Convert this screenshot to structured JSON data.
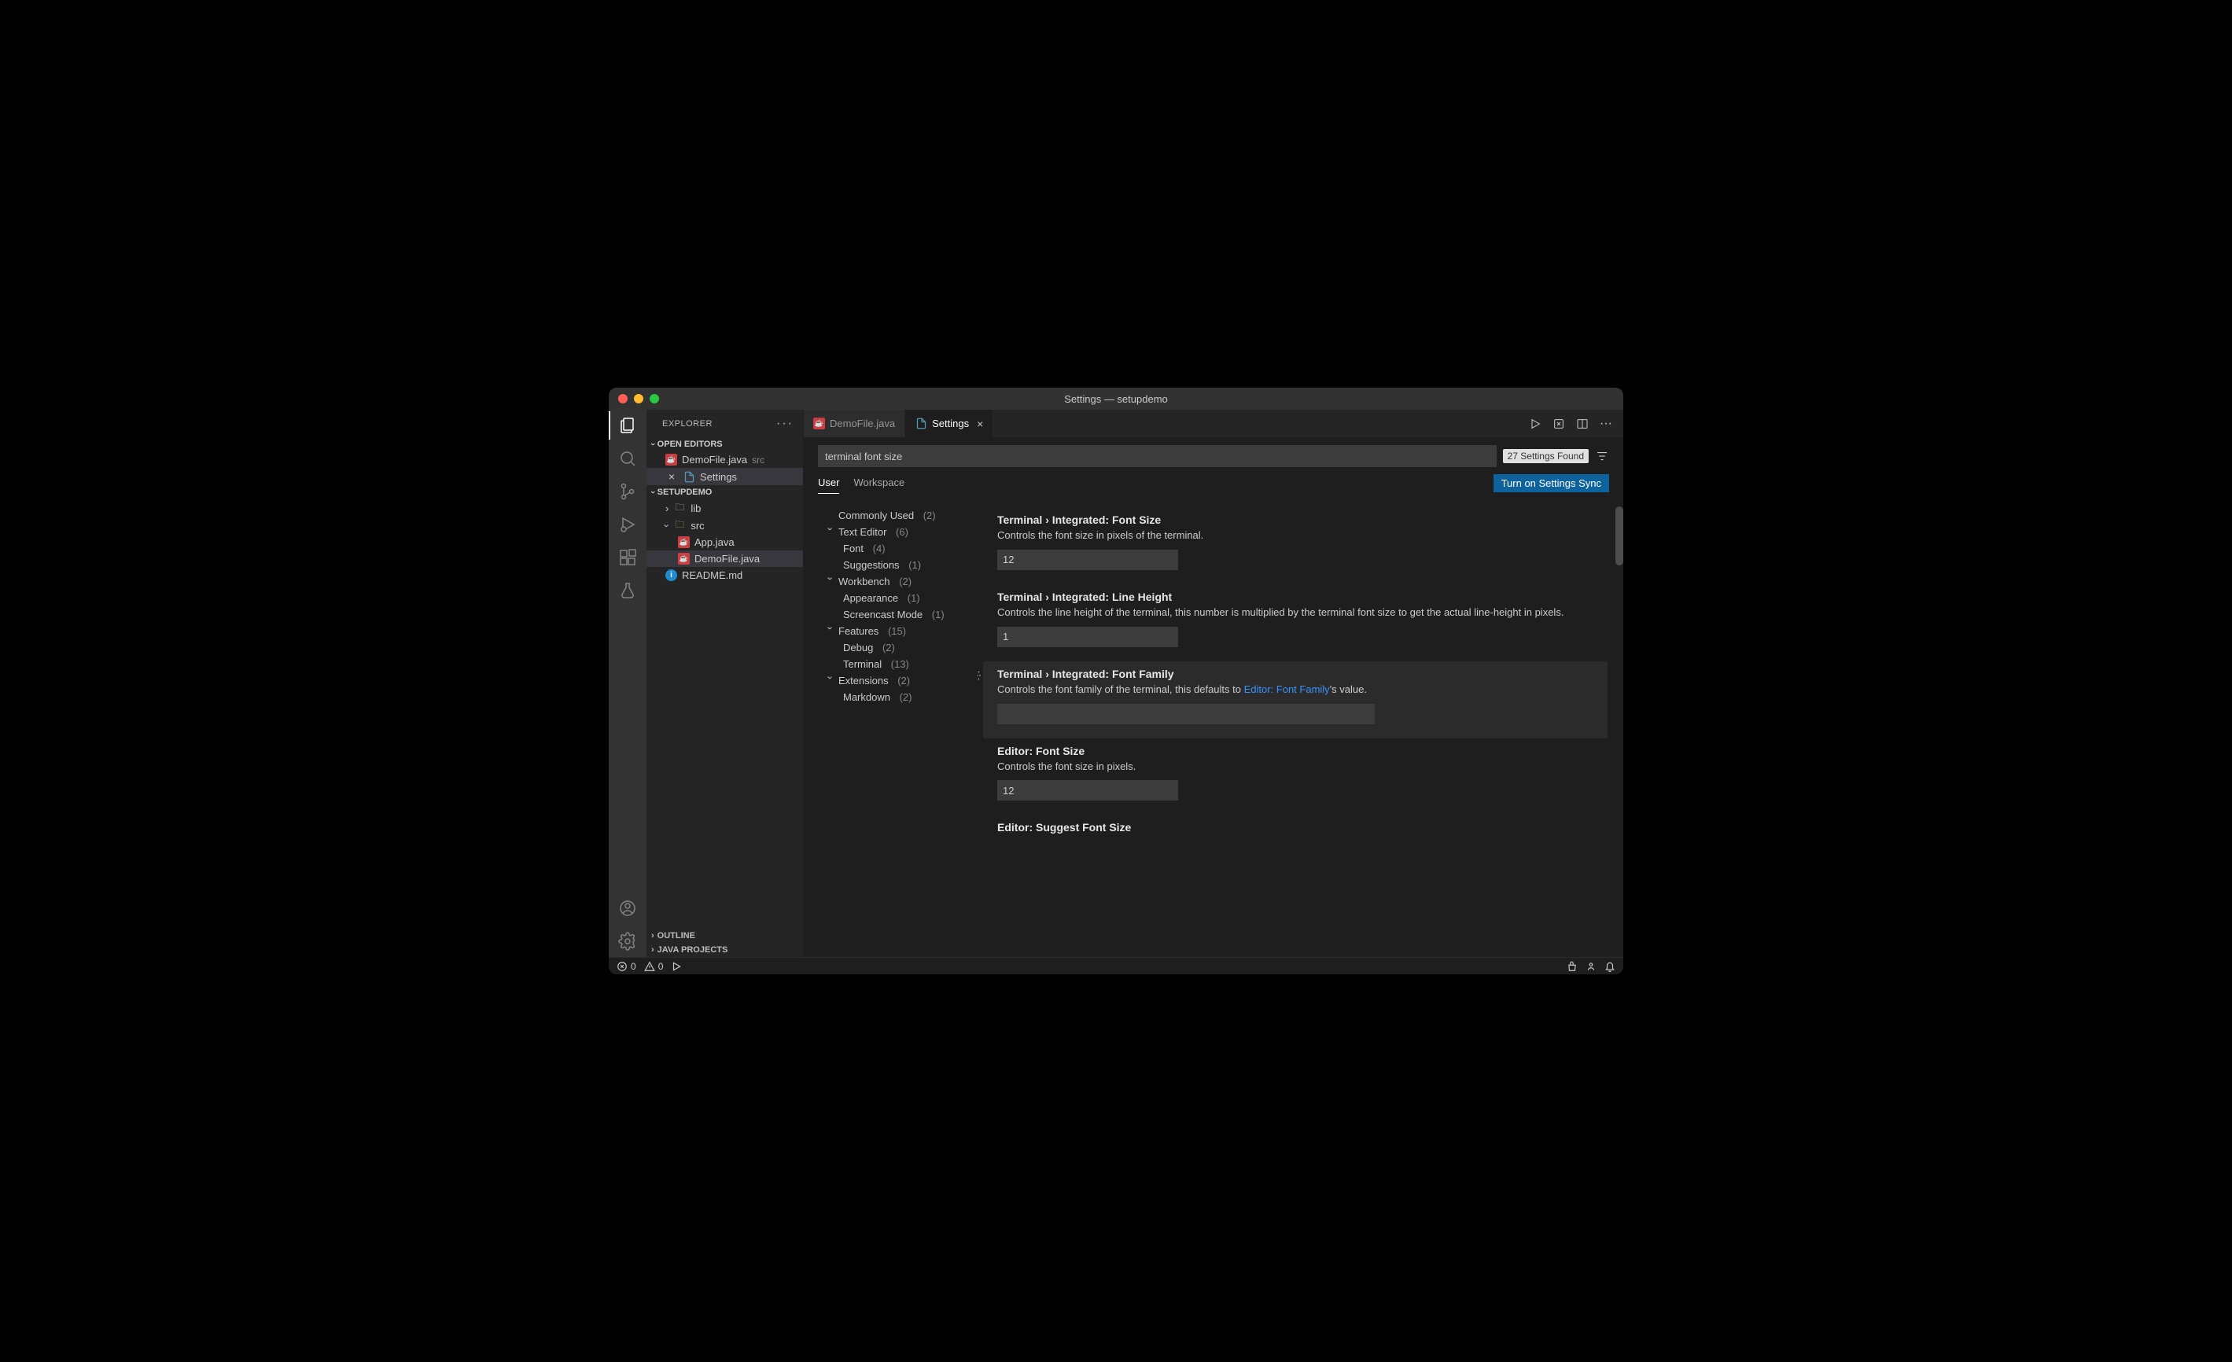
{
  "window": {
    "title": "Settings — setupdemo"
  },
  "sidebar": {
    "title": "EXPLORER",
    "open_editors_label": "OPEN EDITORS",
    "open_editors": [
      {
        "name": "DemoFile.java",
        "hint": "src",
        "icon": "java"
      },
      {
        "name": "Settings",
        "icon": "gear",
        "closable": true
      }
    ],
    "project_label": "SETUPDEMO",
    "tree": [
      {
        "name": "lib",
        "icon": "folder-yellow",
        "chev": "right"
      },
      {
        "name": "src",
        "icon": "folder-green",
        "chev": "down"
      },
      {
        "name": "App.java",
        "icon": "java",
        "indent": 2
      },
      {
        "name": "DemoFile.java",
        "icon": "java",
        "indent": 2,
        "selected": true
      },
      {
        "name": "README.md",
        "icon": "info",
        "indent": 1
      }
    ],
    "outline_label": "OUTLINE",
    "java_projects_label": "JAVA PROJECTS"
  },
  "tabs": [
    {
      "label": "DemoFile.java",
      "icon": "java"
    },
    {
      "label": "Settings",
      "icon": "gear",
      "active": true,
      "closable": true
    }
  ],
  "search": {
    "value": "terminal font size",
    "results_badge": "27 Settings Found"
  },
  "scope": {
    "user": "User",
    "workspace": "Workspace",
    "sync_button": "Turn on Settings Sync"
  },
  "nav": {
    "commonly_used": "Commonly Used",
    "commonly_used_cnt": "(2)",
    "text_editor": "Text Editor",
    "text_editor_cnt": "(6)",
    "font": "Font",
    "font_cnt": "(4)",
    "suggestions": "Suggestions",
    "suggestions_cnt": "(1)",
    "workbench": "Workbench",
    "workbench_cnt": "(2)",
    "appearance": "Appearance",
    "appearance_cnt": "(1)",
    "screencast": "Screencast Mode",
    "screencast_cnt": "(1)",
    "features": "Features",
    "features_cnt": "(15)",
    "debug": "Debug",
    "debug_cnt": "(2)",
    "terminal": "Terminal",
    "terminal_cnt": "(13)",
    "extensions": "Extensions",
    "extensions_cnt": "(2)",
    "markdown": "Markdown",
    "markdown_cnt": "(2)"
  },
  "settings": [
    {
      "title_pre": "Terminal › Integrated: ",
      "title_bold": "Font Size",
      "desc": "Controls the font size in pixels of the terminal.",
      "value": "12"
    },
    {
      "title_pre": "Terminal › Integrated: ",
      "title_bold": "Line Height",
      "desc": "Controls the line height of the terminal, this number is multiplied by the terminal font size to get the actual line-height in pixels.",
      "value": "1"
    },
    {
      "title_pre": "Terminal › Integrated: ",
      "title_bold": "Font Family",
      "desc_pre": "Controls the font family of the terminal, this defaults to ",
      "desc_link": "Editor: Font Family",
      "desc_post": "'s value.",
      "value": "",
      "focused": true,
      "wide": true
    },
    {
      "title_pre": "Editor: ",
      "title_bold": "Font Size",
      "desc": "Controls the font size in pixels.",
      "value": "12"
    },
    {
      "title_pre": "Editor: ",
      "title_bold": "Suggest Font Size",
      "desc": ""
    }
  ],
  "statusbar": {
    "errors": "0",
    "warnings": "0"
  }
}
